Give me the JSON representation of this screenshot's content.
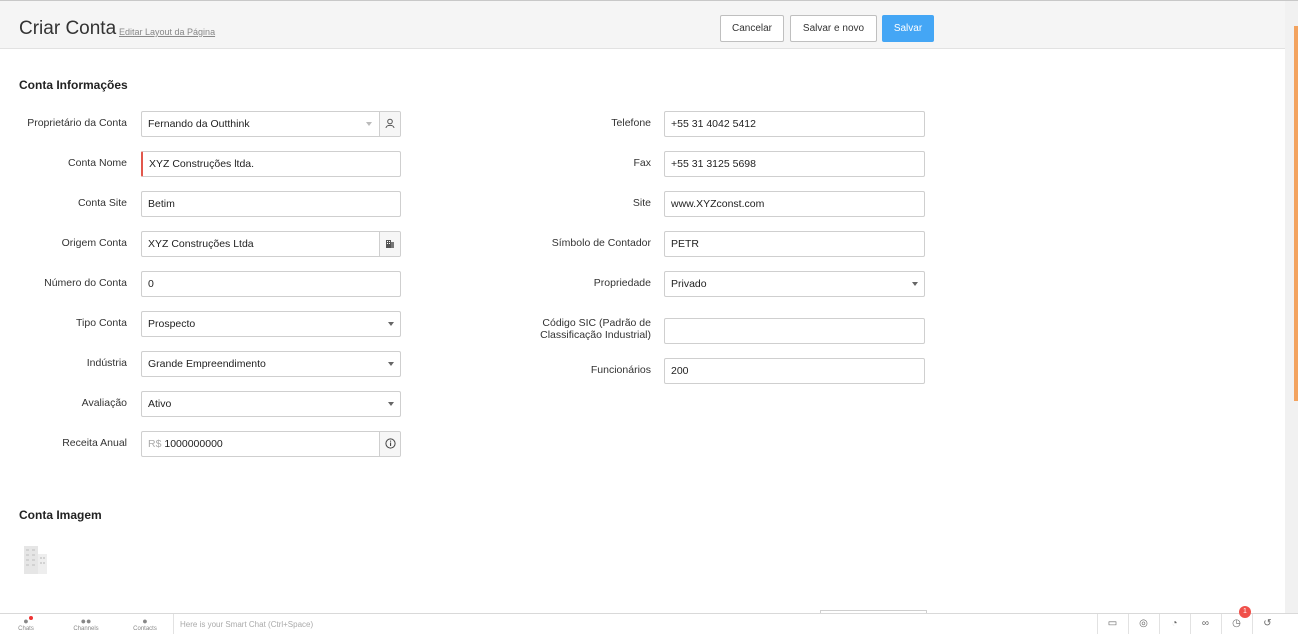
{
  "header": {
    "title": "Criar Conta",
    "edit_layout_link": "Editar Layout da Página",
    "cancel_label": "Cancelar",
    "save_new_label": "Salvar e novo",
    "save_label": "Salvar"
  },
  "section_info": {
    "title": "Conta Informações",
    "left": [
      {
        "label": "Proprietário da Conta",
        "value": "Fernando da Outthink"
      },
      {
        "label": "Conta Nome",
        "value": "XYZ Construções ltda."
      },
      {
        "label": "Conta Site",
        "value": "Betim"
      },
      {
        "label": "Origem Conta",
        "value": "XYZ Construções Ltda"
      },
      {
        "label": "Número do Conta",
        "value": "0"
      },
      {
        "label": "Tipo Conta",
        "value": "Prospecto"
      },
      {
        "label": "Indústria",
        "value": "Grande Empreendimento"
      },
      {
        "label": "Avaliação",
        "value": "Ativo"
      },
      {
        "label": "Receita Anual",
        "prefix": "R$",
        "value": "1000000000"
      }
    ],
    "right": [
      {
        "label": "Telefone",
        "value": "+55 31 4042 5412"
      },
      {
        "label": "Fax",
        "value": "+55 31 3125 5698"
      },
      {
        "label": "Site",
        "value": "www.XYZconst.com"
      },
      {
        "label": "Símbolo de Contador",
        "value": "PETR"
      },
      {
        "label": "Propriedade",
        "value": "Privado"
      },
      {
        "label_line1": "Código SIC (Padrão de",
        "label_line2": "Classificação Industrial)",
        "value": ""
      },
      {
        "label": "Funcionários",
        "value": "200"
      }
    ]
  },
  "section_image": {
    "title": "Conta Imagem"
  },
  "bottom_bar": {
    "tabs": [
      {
        "label": "Chats",
        "icon": "chat-icon"
      },
      {
        "label": "Channels",
        "icon": "channels-icon"
      },
      {
        "label": "Contacts",
        "icon": "contacts-icon"
      }
    ],
    "smart_chat_placeholder": "Here is your Smart Chat (Ctrl+Space)",
    "notification_count": "1",
    "icons": [
      "screen-share-icon",
      "gamepad-icon",
      "timer-icon",
      "bike-icon",
      "alarm-icon",
      "history-icon"
    ]
  },
  "colors": {
    "primary_button": "#44a6f5",
    "required_marker": "#e2574c",
    "badge": "#f0504a"
  }
}
